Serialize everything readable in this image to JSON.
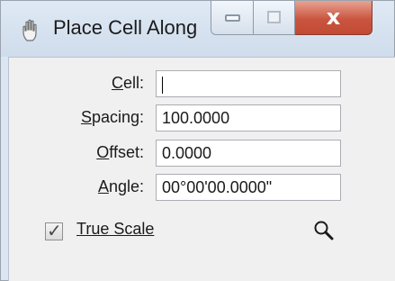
{
  "window": {
    "title": "Place Cell Along",
    "close_glyph": "x"
  },
  "fields": [
    {
      "label_ul": "C",
      "label_rest": "ell:",
      "value": ""
    },
    {
      "label_ul": "S",
      "label_rest": "pacing:",
      "value": "100.0000"
    },
    {
      "label_ul": "O",
      "label_rest": "ffset:",
      "value": "0.0000"
    },
    {
      "label_ul": "A",
      "label_rest": "ngle:",
      "value": "00°00'00.0000\""
    }
  ],
  "true_scale": {
    "label": "True Scale",
    "checked": true,
    "check_glyph": "✓"
  },
  "icons": {
    "app": "hand-icon",
    "search": "magnifier-icon"
  }
}
